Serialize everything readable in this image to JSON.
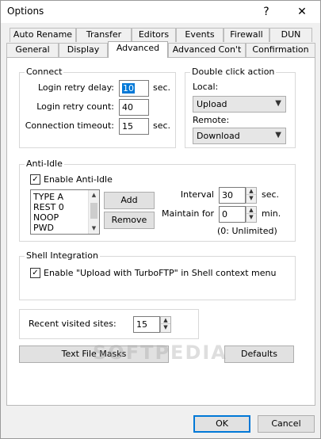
{
  "window": {
    "title": "Options",
    "help_glyph": "?",
    "close_glyph": "✕"
  },
  "tabs_back": [
    {
      "label": "Auto Rename"
    },
    {
      "label": "Transfer"
    },
    {
      "label": "Editors"
    },
    {
      "label": "Events"
    },
    {
      "label": "Firewall"
    },
    {
      "label": "DUN"
    }
  ],
  "tabs_front": [
    {
      "label": "General"
    },
    {
      "label": "Display"
    },
    {
      "label": "Advanced"
    },
    {
      "label": "Advanced Con't"
    },
    {
      "label": "Confirmation"
    }
  ],
  "connect": {
    "title": "Connect",
    "retry_delay_label": "Login retry delay:",
    "retry_delay_value": "10",
    "retry_delay_unit": "sec.",
    "retry_count_label": "Login retry count:",
    "retry_count_value": "40",
    "timeout_label": "Connection timeout:",
    "timeout_value": "15",
    "timeout_unit": "sec."
  },
  "double_click": {
    "title": "Double click action",
    "local_label": "Local:",
    "local_value": "Upload",
    "remote_label": "Remote:",
    "remote_value": "Download"
  },
  "anti_idle": {
    "title": "Anti-Idle",
    "enable_label": "Enable Anti-Idle",
    "commands": [
      "TYPE A",
      "REST 0",
      "NOOP",
      "PWD"
    ],
    "add_label": "Add",
    "remove_label": "Remove",
    "interval_label": "Interval",
    "interval_value": "30",
    "interval_unit": "sec.",
    "maintain_label": "Maintain for",
    "maintain_value": "0",
    "maintain_unit": "min.",
    "unlimited_note": "(0: Unlimited)"
  },
  "shell": {
    "title": "Shell Integration",
    "enable_label": "Enable \"Upload with TurboFTP\" in Shell context menu"
  },
  "recent": {
    "label": "Recent visited sites:",
    "value": "15"
  },
  "buttons": {
    "text_masks": "Text File Masks",
    "defaults": "Defaults",
    "ok": "OK",
    "cancel": "Cancel"
  },
  "watermark": "SOFTPEDIA"
}
